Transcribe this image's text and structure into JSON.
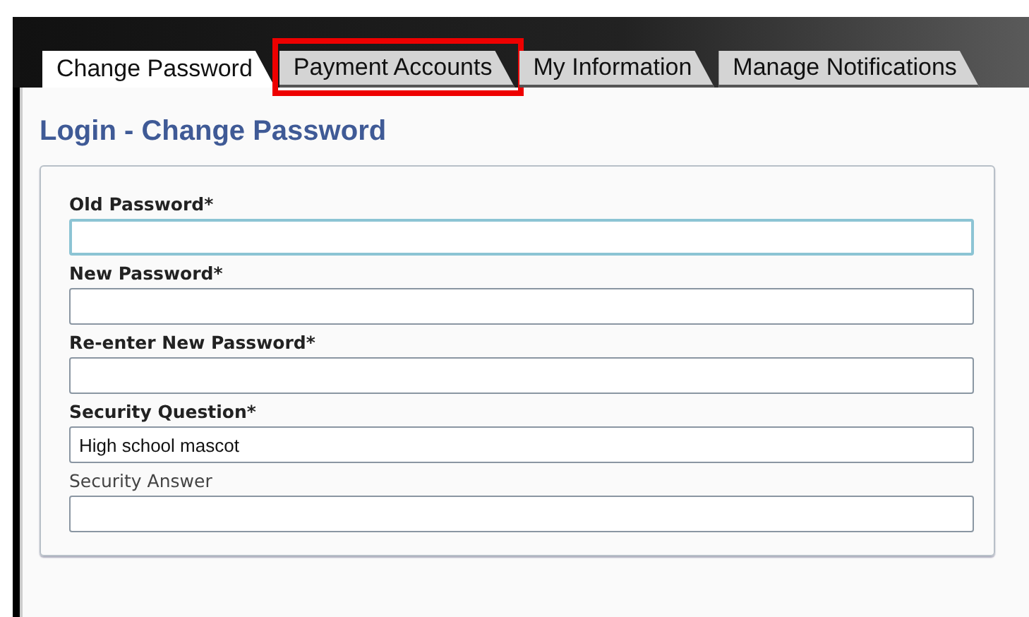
{
  "tabs": [
    {
      "label": "Change Password",
      "selected": true,
      "highlighted": false
    },
    {
      "label": "Payment Accounts",
      "selected": false,
      "highlighted": true
    },
    {
      "label": "My Information",
      "selected": false,
      "highlighted": false
    },
    {
      "label": "Manage Notifications",
      "selected": false,
      "highlighted": false
    }
  ],
  "page_title": "Login - Change Password",
  "fields": [
    {
      "label": "Old Password*",
      "required": true,
      "focused": true
    },
    {
      "label": "New Password*",
      "required": true,
      "focused": false
    },
    {
      "label": "Re-enter New Password*",
      "required": true,
      "focused": false
    },
    {
      "label": "Security Question*",
      "required": true,
      "focused": false,
      "value": "High school mascot"
    },
    {
      "label": "Security Answer",
      "required": false,
      "focused": false
    }
  ]
}
